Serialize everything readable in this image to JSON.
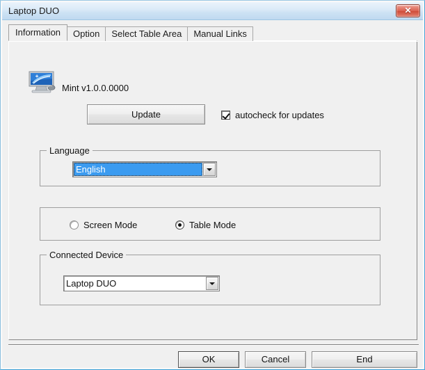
{
  "window": {
    "title": "Laptop DUO",
    "close_icon": "close-icon",
    "close_glyph": "✕",
    "border_color": "#6fb7e0",
    "titlebar_color": "#cde2f4"
  },
  "tabs": [
    {
      "label": "Information",
      "active": true
    },
    {
      "label": "Option",
      "active": false
    },
    {
      "label": "Select Table Area",
      "active": false
    },
    {
      "label": "Manual Links",
      "active": false
    }
  ],
  "information": {
    "app_icon": "monitor-icon",
    "version_text": "Mint v1.0.0.0000",
    "update_button_label": "Update",
    "autocheck": {
      "label": "autocheck for updates",
      "checked": true
    },
    "language_group": {
      "title": "Language",
      "selected": "English",
      "highlight_color": "#3b9bf0",
      "focused": true
    },
    "mode_group": {
      "options": [
        {
          "label": "Screen Mode",
          "selected": false
        },
        {
          "label": "Table Mode",
          "selected": true
        }
      ]
    },
    "device_group": {
      "title": "Connected Device",
      "selected": "Laptop DUO"
    }
  },
  "footer": {
    "ok_label": "OK",
    "cancel_label": "Cancel",
    "end_label": "End"
  }
}
